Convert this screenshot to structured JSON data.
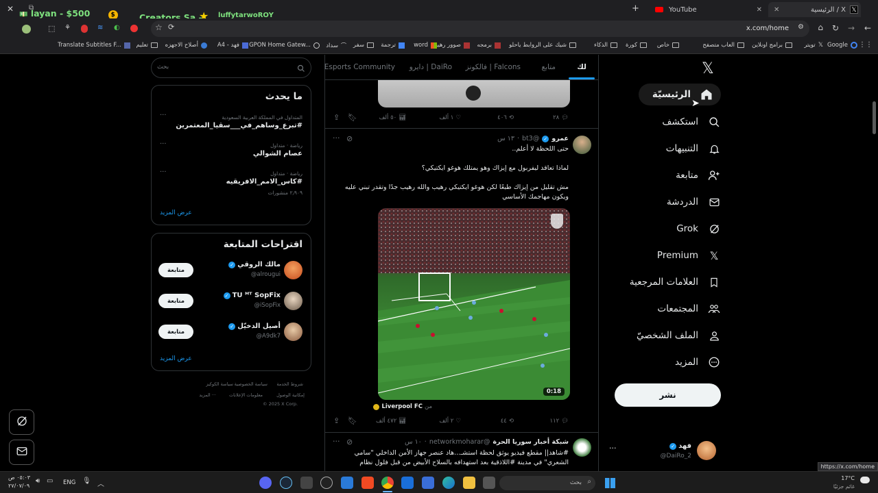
{
  "browser": {
    "tabs": [
      {
        "label": "الرئيسية / X"
      },
      {
        "label": "YouTube"
      }
    ],
    "url": "x.com/home",
    "status_url": "https://x.com/home",
    "bookmarks": [
      "Google",
      "تويتر",
      "برامج اونلاين",
      "العاب متصفح",
      "خاص",
      "كورة",
      "الذكاء",
      "شيك على الروابط ياحلو",
      "برمجه",
      "صوور رهيبه",
      "word",
      "ترجمة",
      "سفر",
      "سداد",
      "GPON Home Gatew...",
      "فهد - A4",
      "أصلاح الاجهزه",
      "تعليم",
      "Translate Subtitles F..."
    ]
  },
  "stream_overlay": {
    "donation": "layan - $500",
    "creators": "Creators Sa -",
    "user": "luffytarwoROY"
  },
  "nav": {
    "items": [
      {
        "label": "الرئيسيّة",
        "icon": "home-icon"
      },
      {
        "label": "استكشف",
        "icon": "search-icon"
      },
      {
        "label": "التنبيهات",
        "icon": "bell-icon"
      },
      {
        "label": "متابعة",
        "icon": "add-person-icon"
      },
      {
        "label": "الدردشة",
        "icon": "mail-icon"
      },
      {
        "label": "Grok",
        "icon": "grok-icon"
      },
      {
        "label": "Premium",
        "icon": "x-logo-icon"
      },
      {
        "label": "العلامات المرجعية",
        "icon": "bookmark-icon"
      },
      {
        "label": "المجتمعات",
        "icon": "communities-icon"
      },
      {
        "label": "الملف الشخصيّ",
        "icon": "profile-icon"
      },
      {
        "label": "المزيد",
        "icon": "more-circle-icon"
      }
    ],
    "post_button": "نشر",
    "account": {
      "name": "فهد",
      "handle": "@DaiRo_2"
    }
  },
  "feed": {
    "tabs": [
      "لك",
      "متابع",
      "فالكونز | Falcons",
      "دايرو | DaiRo",
      "Esports Community"
    ],
    "first_stats": {
      "replies": "٢٨",
      "reposts": "٤٠٦",
      "likes": "١ ألف",
      "views": "٥٠ ألف"
    },
    "tweet1": {
      "name": "عمرو",
      "handle": "@bt3",
      "time": "١٣ س",
      "line1": "حتى اللحظة لا أعلم..",
      "line2": "لماذا تعاقد ليفربول مع إيزاك وهو يمتلك هوغو ايكتيكي؟",
      "line3": "مش تقليل من إيزاك طبعًا لكن هوغو ايكتيكي رهيب والله رهيب جدًا وتقدر تبني عليه",
      "line4": "ويكون مهاجمك الأساسي",
      "video_duration": "0:18",
      "from_label": "من",
      "source": "Liverpool FC",
      "stats": {
        "replies": "١١٢",
        "reposts": "٤٤",
        "likes": "٢ ألف",
        "views": "٤٧٢ ألف"
      }
    },
    "tweet2": {
      "name": "شبكة أخبار سوريا الحرة",
      "handle": "@networkmoharar",
      "time": "١٠ س",
      "line1": "#شاهد|| مقطع فيديو يوثق لحظة استشـ...هاد عنصر جهاز الأمن الداخلي \"سامي",
      "line2": "الشعري\" في مدينة #اللاذقية بعد استهدافه بالسلاح الأبيض من قبل فلول نظام"
    }
  },
  "sidebar": {
    "search_placeholder": "بحث",
    "trends_title": "ما يحدث",
    "trends": [
      {
        "category": "المتداول في المملكة العربية السعودية",
        "name": "#تبرع_وساهم_في___سقيا_المعتمرين",
        "count": ""
      },
      {
        "category": "رياضة · متداول",
        "name": "عصام الشوالي",
        "count": ""
      },
      {
        "category": "رياضة · متداول",
        "name": "#كاس_الامم_الافريقيه",
        "count": "٢٫٩٠٩ منشورات"
      }
    ],
    "show_more": "عرض المزيد",
    "suggestions_title": "اقتراحات المتابعة",
    "suggestions": [
      {
        "name": "مالك الروقي",
        "handle": "@alrougui",
        "button": "متابعة"
      },
      {
        "name": "TU ᴹᵀ SopFix",
        "handle": "@iSopFix",
        "button": "متابعة"
      },
      {
        "name": "أصيل الدخيّل",
        "handle": "@A9dk7",
        "button": "متابعة"
      }
    ],
    "footer": {
      "terms": "شروط الخدمة",
      "privacy": "سياسة الخصوصية",
      "cookies": "سياسة الكوكيز",
      "accessibility": "إمكانية الوصول",
      "ads": "معلومات الإعلانات",
      "more": "··· المزيد",
      "copyright": "© 2025 X Corp."
    }
  },
  "taskbar": {
    "search_placeholder": "بحث",
    "lang": "ENG",
    "time": "٠٥:٠٣ ص",
    "date": "٢٧/٠٧/٠٩",
    "weather_temp": "17°C",
    "weather_desc": "غائم جزئيًا"
  }
}
